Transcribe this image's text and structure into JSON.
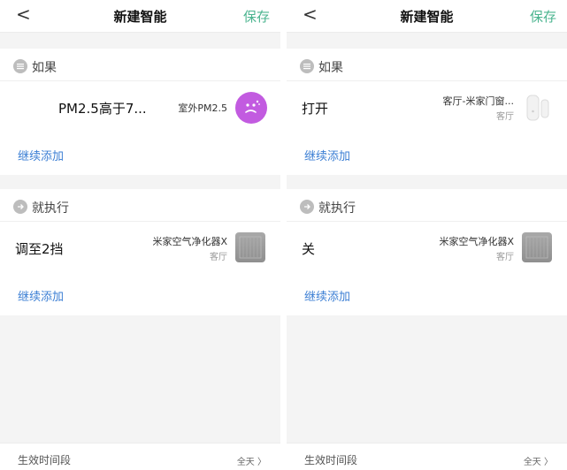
{
  "panels": [
    {
      "header": {
        "back_glyph": "<",
        "title": "新建智能",
        "save_label": "保存"
      },
      "if_section": {
        "label": "如果"
      },
      "condition": {
        "text": "PM2.5高于7...",
        "source": "室外PM2.5",
        "icon": "pm25-icon"
      },
      "if_add": "继续添加",
      "then_section": {
        "label": "就执行"
      },
      "action": {
        "text": "调至2挡",
        "device": "米家空气净化器X",
        "room": "客厅",
        "icon": "air-purifier-icon"
      },
      "then_add": "继续添加",
      "footer": {
        "label": "生效时间段",
        "value": "全天 〉"
      }
    },
    {
      "header": {
        "back_glyph": "<",
        "title": "新建智能",
        "save_label": "保存"
      },
      "if_section": {
        "label": "如果"
      },
      "condition": {
        "text": "打开",
        "source": "客厅-米家门窗...",
        "room": "客厅",
        "icon": "door-window-sensor-icon"
      },
      "if_add": "继续添加",
      "then_section": {
        "label": "就执行"
      },
      "action": {
        "text": "关",
        "device": "米家空气净化器X",
        "room": "客厅",
        "icon": "air-purifier-icon"
      },
      "then_add": "继续添加",
      "footer": {
        "label": "生效时间段",
        "value": "全天 〉"
      }
    }
  ],
  "colors": {
    "accent_green": "#4bb48f",
    "link_blue": "#3c7fd4",
    "pm_icon_purple": "#c25be0",
    "background_gray": "#f4f4f4"
  }
}
